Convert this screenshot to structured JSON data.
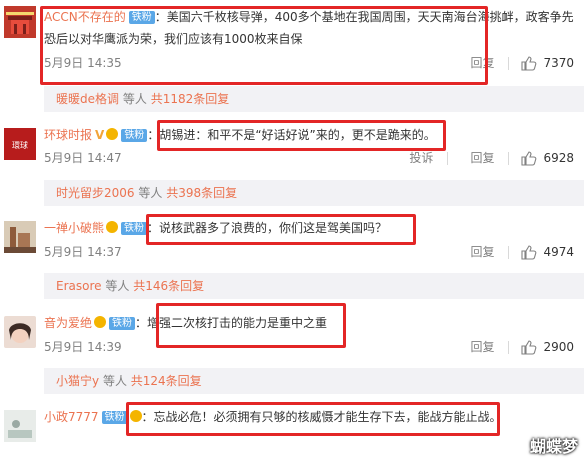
{
  "comments": [
    {
      "user": "ACCN不存在的",
      "badge": "铁粉",
      "text": "：美国六千枚核导弹，400多个基地在我国周围，天天南海台海挑衅，政客争先恐后以对华鹰派为荣，我们应该有1000枚来自保",
      "time": "5月9日 14:35",
      "reply": "回复",
      "likes": "7370",
      "summary_user": "暖暖de格调",
      "summary_text": "等人",
      "summary_count": "共1182条回复"
    },
    {
      "user": "环球时报",
      "badge": "铁粉",
      "text": "：胡锡进：和平不是“好话好说”来的，更不是跪来的。",
      "time": "5月9日 14:47",
      "report": "投诉",
      "reply": "回复",
      "likes": "6928",
      "summary_user": "时光留步2006",
      "summary_text": "等人",
      "summary_count": "共398条回复"
    },
    {
      "user": "一禅小破熊",
      "badge": "铁粉",
      "text": "：说核武器多了浪费的，你们这是驾美国吗？",
      "time": "5月9日 14:37",
      "reply": "回复",
      "likes": "4974",
      "summary_user": "Erasore",
      "summary_text": "等人",
      "summary_count": "共146条回复"
    },
    {
      "user": "音为爱绝",
      "badge": "铁粉",
      "text": "：增强二次核打击的能力是重中之重",
      "time": "5月9日 14:39",
      "reply": "回复",
      "likes": "2900",
      "summary_user": "小猫宁y",
      "summary_text": "等人",
      "summary_count": "共124条回复"
    },
    {
      "user": "小政7777",
      "badge": "铁粉",
      "text": "：忘战必危！必须拥有只够的核威慑才能生存下去，能战方能止战。"
    }
  ],
  "watermark": "蝴蝶梦",
  "colors": {
    "username": "#eb7350",
    "highlight": "#e32626",
    "badge": "#5aa7e7"
  },
  "icons": {
    "like": "thumbs-up-icon",
    "verified": "v-verified-icon",
    "fan": "heart-fan-icon"
  }
}
